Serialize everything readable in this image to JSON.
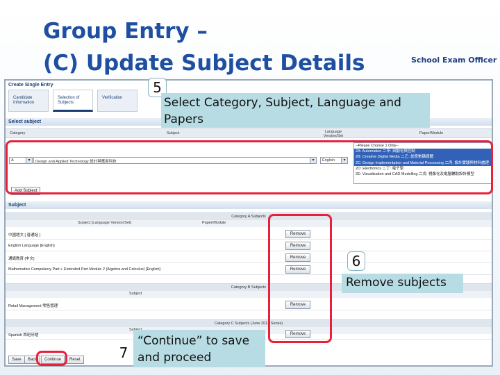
{
  "slide": {
    "title": "Group Entry –\n(C) Update Subject Details",
    "subtitle": "School Exam Officer"
  },
  "screen": {
    "title": "Create Single Entry",
    "tabs": [
      {
        "label": "Candidate Information",
        "active": false
      },
      {
        "label": "Selection of Subjects",
        "active": true
      },
      {
        "label": "Verification",
        "active": false
      }
    ],
    "select_section": {
      "label": "Select subject",
      "columns": [
        "Category",
        "Subject",
        "Language Version/Set",
        "Paper/Module"
      ],
      "category_value": "A",
      "subject_value": "Design and Applied Technology 設計與應用科技",
      "language_value": "English",
      "papers": [
        {
          "label": "--Please Choose 1 Only--",
          "selected": false
        },
        {
          "label": "2A: Automation 二甲: 自動化與控制",
          "selected": true
        },
        {
          "label": "2B: Creative Digital Media 二乙: 創意數碼媒體",
          "selected": true
        },
        {
          "label": "2C: Design Implementation and Material Processing 二丙: 設計實踐與材料處理",
          "selected": true
        },
        {
          "label": "2D: Electronics 二丁: 電子學",
          "selected": false
        },
        {
          "label": "2E: Visualisation and CAD Modelling 二戊: 視像化及電腦輔助設計模型",
          "selected": false
        }
      ],
      "add_button": "Add Subject"
    },
    "subject_section": {
      "label": "Subject",
      "cat_a": {
        "title": "Category A Subjects",
        "col_subject": "Subject [Language Version/Set]",
        "col_paper": "Paper/Module",
        "rows": [
          "中國語文 [ 普通話 ]",
          "English Language [English]",
          "通識教育 [中文]",
          "Mathematics Compulsory Part + Extended Part Module 2 (Algebra and Calculus) [English]"
        ]
      },
      "cat_b": {
        "title": "Category B Subjects",
        "col_subject": "Subject",
        "rows": [
          "Retail Management 零售管理"
        ]
      },
      "cat_c": {
        "title": "Category C Subjects (June 2012 Series)",
        "col_subject": "Subject",
        "rows": [
          "Spanish 西班牙語"
        ]
      },
      "remove_label": "Remove"
    },
    "footer_buttons": [
      "Save",
      "Back",
      "Continue",
      "Reset"
    ]
  },
  "callouts": {
    "step5": {
      "number": "5",
      "text": "Select Category, Subject, Language and Papers"
    },
    "step6": {
      "number": "6",
      "text": "Remove subjects"
    },
    "step7": {
      "number": "7",
      "text": "“Continue” to save and proceed"
    }
  },
  "colors": {
    "title": "#1f4fa0",
    "highlight": "#e8203a",
    "callout_bg": "#b8dce3",
    "selected_option": "#3162b8"
  }
}
